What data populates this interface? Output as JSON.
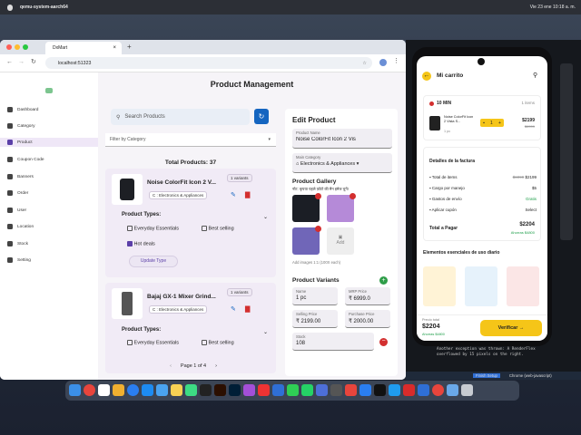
{
  "menubar": {
    "app": "qemu-system-aarch64",
    "clock": "Vie 23 ene  10:18 a. m."
  },
  "browser": {
    "tab_title": "DxMart",
    "url": "localhost:51323"
  },
  "sidebar": {
    "items": [
      {
        "label": "Dashboard"
      },
      {
        "label": "Category"
      },
      {
        "label": "Product"
      },
      {
        "label": "Coupon Code"
      },
      {
        "label": "Banners"
      },
      {
        "label": "Order"
      },
      {
        "label": "User"
      },
      {
        "label": "Location"
      },
      {
        "label": "Stock"
      },
      {
        "label": "Setting"
      }
    ]
  },
  "page": {
    "title": "Product Management",
    "search_placeholder": "Search Products",
    "filter_label": "Filter by Category",
    "total": "Total Products: 37",
    "pagination": "Page 1 of 4"
  },
  "products": [
    {
      "name": "Noise ColorFit Icon 2 V...",
      "variants": "1 variants",
      "category": "C : Electronics & Appliances",
      "types_label": "Product Types:",
      "types": [
        {
          "label": "Everyday Essentials",
          "checked": false
        },
        {
          "label": "Best selling",
          "checked": false
        },
        {
          "label": "Hot deals",
          "checked": true
        }
      ],
      "update": "Update Type"
    },
    {
      "name": "Bajaj GX-1 Mixer Grind...",
      "variants": "1 variants",
      "category": "C : Electronics & Appliances",
      "types_label": "Product Types:",
      "types": [
        {
          "label": "Everyday Essentials",
          "checked": false
        },
        {
          "label": "Best selling",
          "checked": false
        }
      ]
    }
  ],
  "edit": {
    "title": "Edit Product",
    "name_label": "Product Name",
    "name_value": "Noise ColorFit Icon 2 Vis",
    "cat_label": "Main Category",
    "cat_value": "Electronics & Appliances",
    "gallery_title": "Product Gallery",
    "gallery_note": "नोट: कृपया पहले फ़ोटो की मैन इमेज चुनें!",
    "add_label": "Add",
    "gallery_count": "Add images 1:1 (100X each)",
    "variants_title": "Product Variants",
    "name2_label": "Name",
    "name2_value": "1 pc",
    "mrp_label": "MRP Price",
    "mrp_value": "₹ 6999.0",
    "sell_label": "Selling Price",
    "sell_value": "₹ 2199.00",
    "purchase_label": "Purchase Price",
    "purchase_value": "₹ 2000.00",
    "stock_label": "Stock",
    "stock_value": "108"
  },
  "phone": {
    "title": "Mi carrito",
    "delivery": "10 MIN",
    "items_count": "1 items",
    "item_name": "Noise ColorFit Icon 2 Vista S...",
    "item_qty": "1",
    "item_unit": "1 pc",
    "item_price": "$2199",
    "item_old": "$6999",
    "bill_title": "Detalles de la factura",
    "rows": [
      {
        "label": "Total de items",
        "old": "$6999",
        "value": "$2199"
      },
      {
        "label": "Cargo por manejo",
        "value": "$5"
      },
      {
        "label": "Gastos de envío",
        "value": "Gratis"
      },
      {
        "label": "Aplicar cupón",
        "value": "Select"
      }
    ],
    "pay_label": "Total a Pagar",
    "pay_value": "$2204",
    "savings": "Ahorras $4800",
    "essentials": "Elementos esenciales de uso diario",
    "footer_label": "Precio total",
    "footer_total": "$2204",
    "footer_save": "Ahorras $4800",
    "verify": "Verificar"
  },
  "terminal": {
    "lines": [
      "overflowed by 87 pixels on the right.",
      "Another exception was thrown: A RenderFlex",
      "overflowed by 15 pixels on the right."
    ],
    "status": [
      "Finish Setup",
      "Chrome (web-javascript)"
    ]
  },
  "colors": {
    "accent": "#5b3fa8",
    "blue": "#1565c0",
    "yellow": "#f5c518",
    "green": "#1e9e4a"
  }
}
